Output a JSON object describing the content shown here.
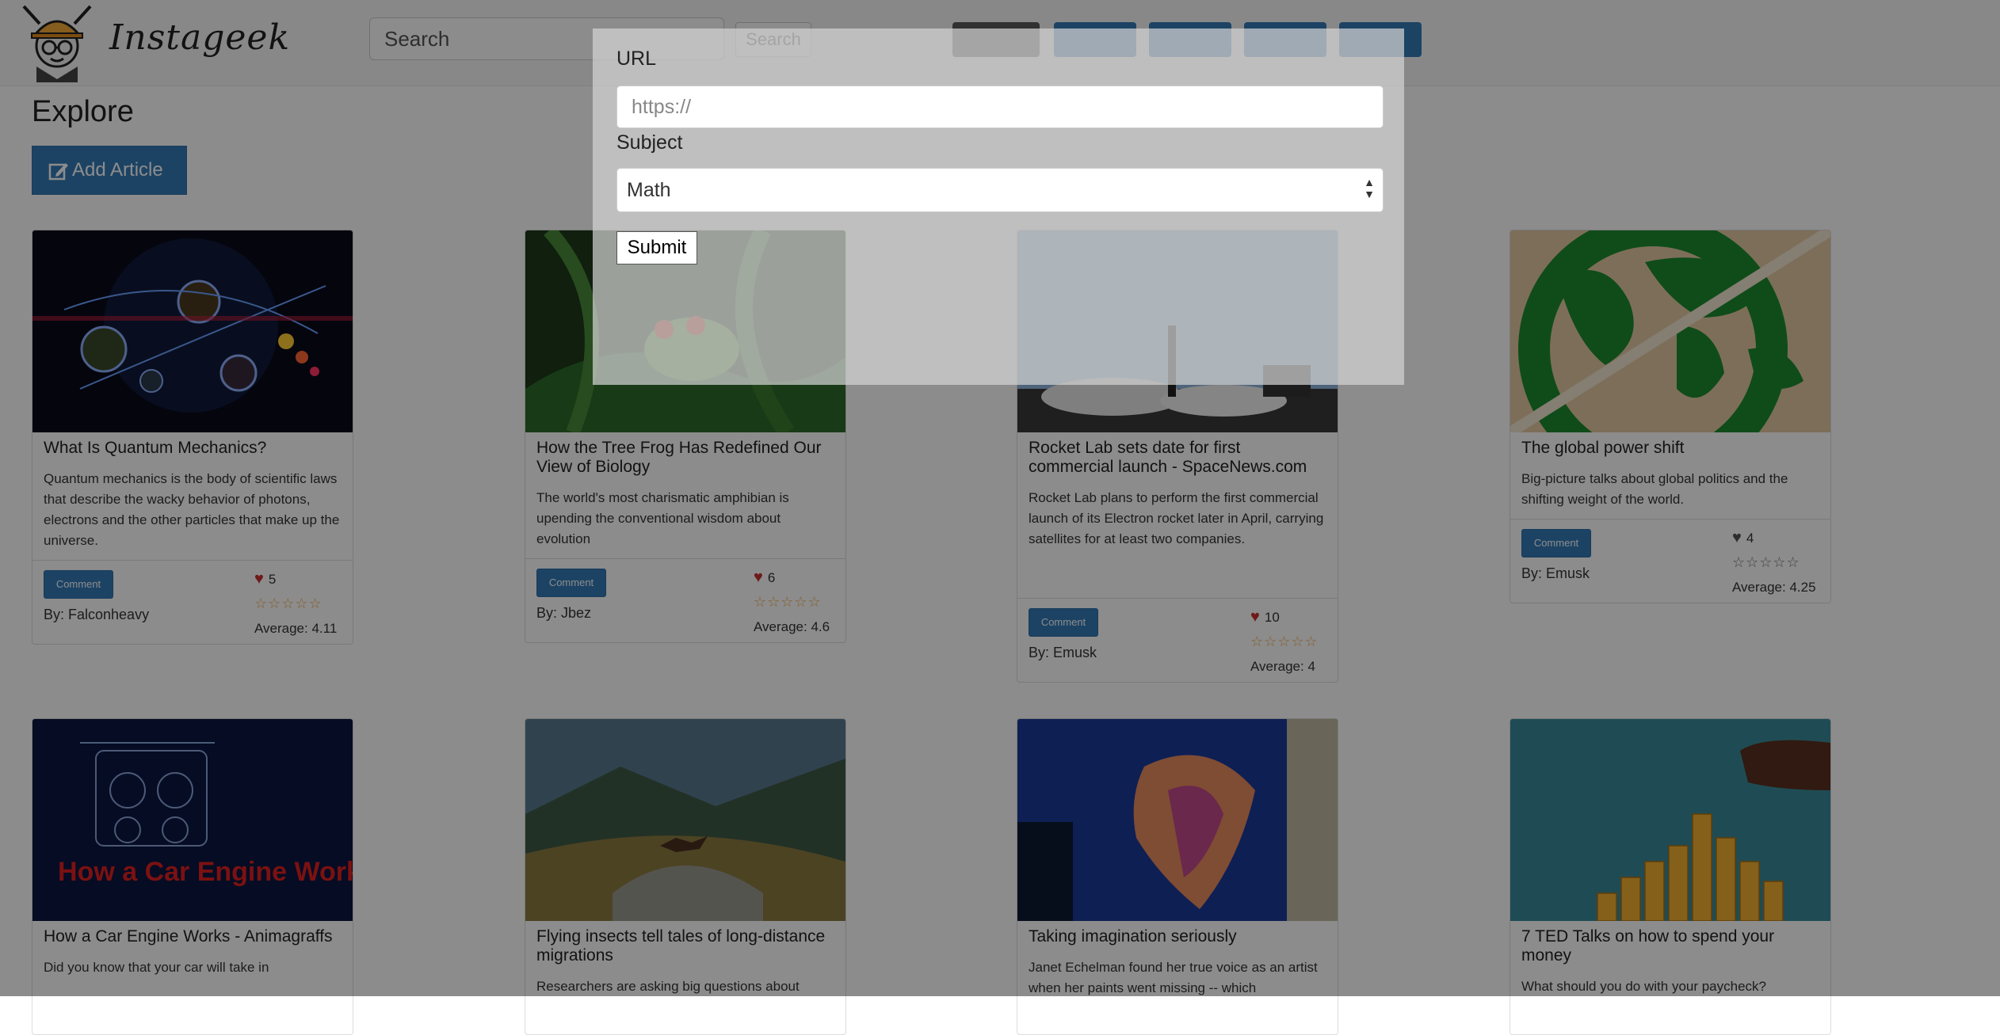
{
  "navbar": {
    "brand": "Instageek",
    "search_placeholder": "Search",
    "search_button": "Search",
    "nav_buttons": [
      "",
      "",
      "",
      "",
      ""
    ]
  },
  "page": {
    "title": "Explore",
    "add_article": "Add Article"
  },
  "modal": {
    "url_label": "URL",
    "url_placeholder": "https://",
    "subject_label": "Subject",
    "subject_selected": "Math",
    "submit": "Submit"
  },
  "cards": [
    {
      "title": "What Is Quantum Mechanics?",
      "desc": "Quantum mechanics is the body of scientific laws that describe the wacky behavior of photons, electrons and the other particles that make up the universe.",
      "comment": "Comment",
      "author": "By: Falconheavy",
      "likes": "5",
      "rating": 4.11,
      "average": "Average: 4.11",
      "heart": "red"
    },
    {
      "title": "How the Tree Frog Has Redefined Our View of Biology",
      "desc": "The world's most charismatic amphibian is upending the conventional wisdom about evolution",
      "comment": "Comment",
      "author": "By: Jbez",
      "likes": "6",
      "rating": 4.6,
      "average": "Average: 4.6",
      "heart": "red"
    },
    {
      "title": "Rocket Lab sets date for first commercial launch - SpaceNews.com",
      "desc": "Rocket Lab plans to perform the first commercial launch of its Electron rocket later in April, carrying satellites for at least two companies.",
      "comment": "Comment",
      "author": "By: Emusk",
      "likes": "10",
      "rating": 4,
      "average": "Average: 4",
      "heart": "red"
    },
    {
      "title": "The global power shift",
      "desc": "Big-picture talks about global politics and the shifting weight of the world.",
      "comment": "Comment",
      "author": "By: Emusk",
      "likes": "4",
      "rating": 4.25,
      "average": "Average: 4.25",
      "heart": "grey"
    },
    {
      "title": "How a Car Engine Works - Animagraffs",
      "desc": "Did you know that your car will take in"
    },
    {
      "title": "Flying insects tell tales of long-distance migrations",
      "desc": "Researchers are asking big questions about"
    },
    {
      "title": "Taking imagination seriously",
      "desc": "Janet Echelman found her true voice as an artist when her paints went missing -- which"
    },
    {
      "title": "7 TED Talks on how to spend your money",
      "desc": "What should you do with your paycheck?"
    }
  ],
  "icons": {
    "heart": "♥",
    "star": "☆",
    "stars_display": "☆☆☆☆☆",
    "select_arrows": "▲▼",
    "edit": "edit-icon"
  },
  "image_text": {
    "engine_poster": "How a Car Engine Works"
  }
}
